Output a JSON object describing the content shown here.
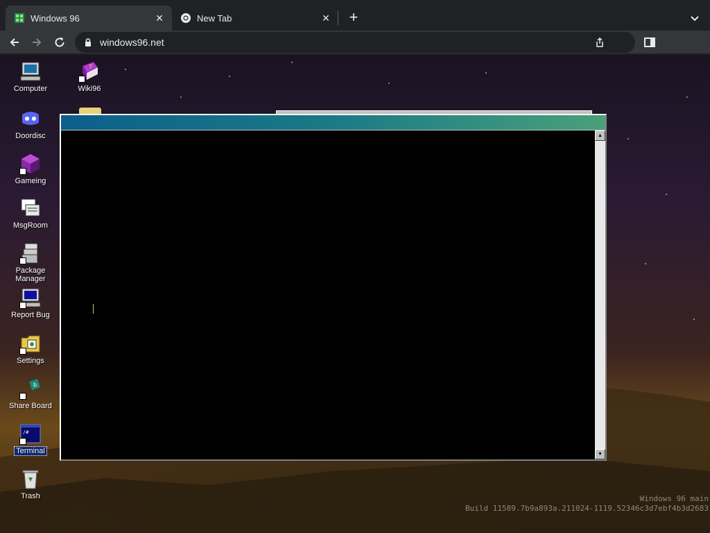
{
  "browser": {
    "tabs": [
      {
        "title": "Windows 96",
        "active": true,
        "favicon": "windows96-logo-icon"
      },
      {
        "title": "New Tab",
        "active": false,
        "favicon": "chrome-icon"
      }
    ],
    "new_tab_label": "+",
    "url": "windows96.net",
    "colors": {
      "frame": "#202124",
      "toolbar": "#35363a",
      "text": "#e8eaed"
    }
  },
  "desktop": {
    "icons": [
      {
        "label": "Computer",
        "icon": "computer-icon"
      },
      {
        "label": "Wiki96",
        "icon": "help-book-icon"
      },
      {
        "label": "Doordisc",
        "icon": "discord-icon"
      },
      {
        "label": "Gameing",
        "icon": "game-cube-icon"
      },
      {
        "label": "MsgRoom",
        "icon": "chat-icon"
      },
      {
        "label": "Package Manager",
        "icon": "package-icon"
      },
      {
        "label": "Report Bug",
        "icon": "bug-report-icon"
      },
      {
        "label": "Settings",
        "icon": "settings-icon"
      },
      {
        "label": "Share Board",
        "icon": "share-board-icon"
      },
      {
        "label": "Terminal",
        "icon": "terminal-icon"
      },
      {
        "label": "Trash",
        "icon": "trash-icon"
      }
    ],
    "watermark": {
      "line1": "Windows 96 main",
      "line2": "Build 11589.7b9a893a.211024-1119.52346c3d7ebf4b3d2683"
    }
  },
  "terminal": {
    "title": "",
    "content": "",
    "scroll_up_glyph": "▲",
    "scroll_down_glyph": "▼",
    "colors": {
      "title_start": "#0b5f8a",
      "title_end": "#4aa07a",
      "background": "#000000"
    }
  }
}
